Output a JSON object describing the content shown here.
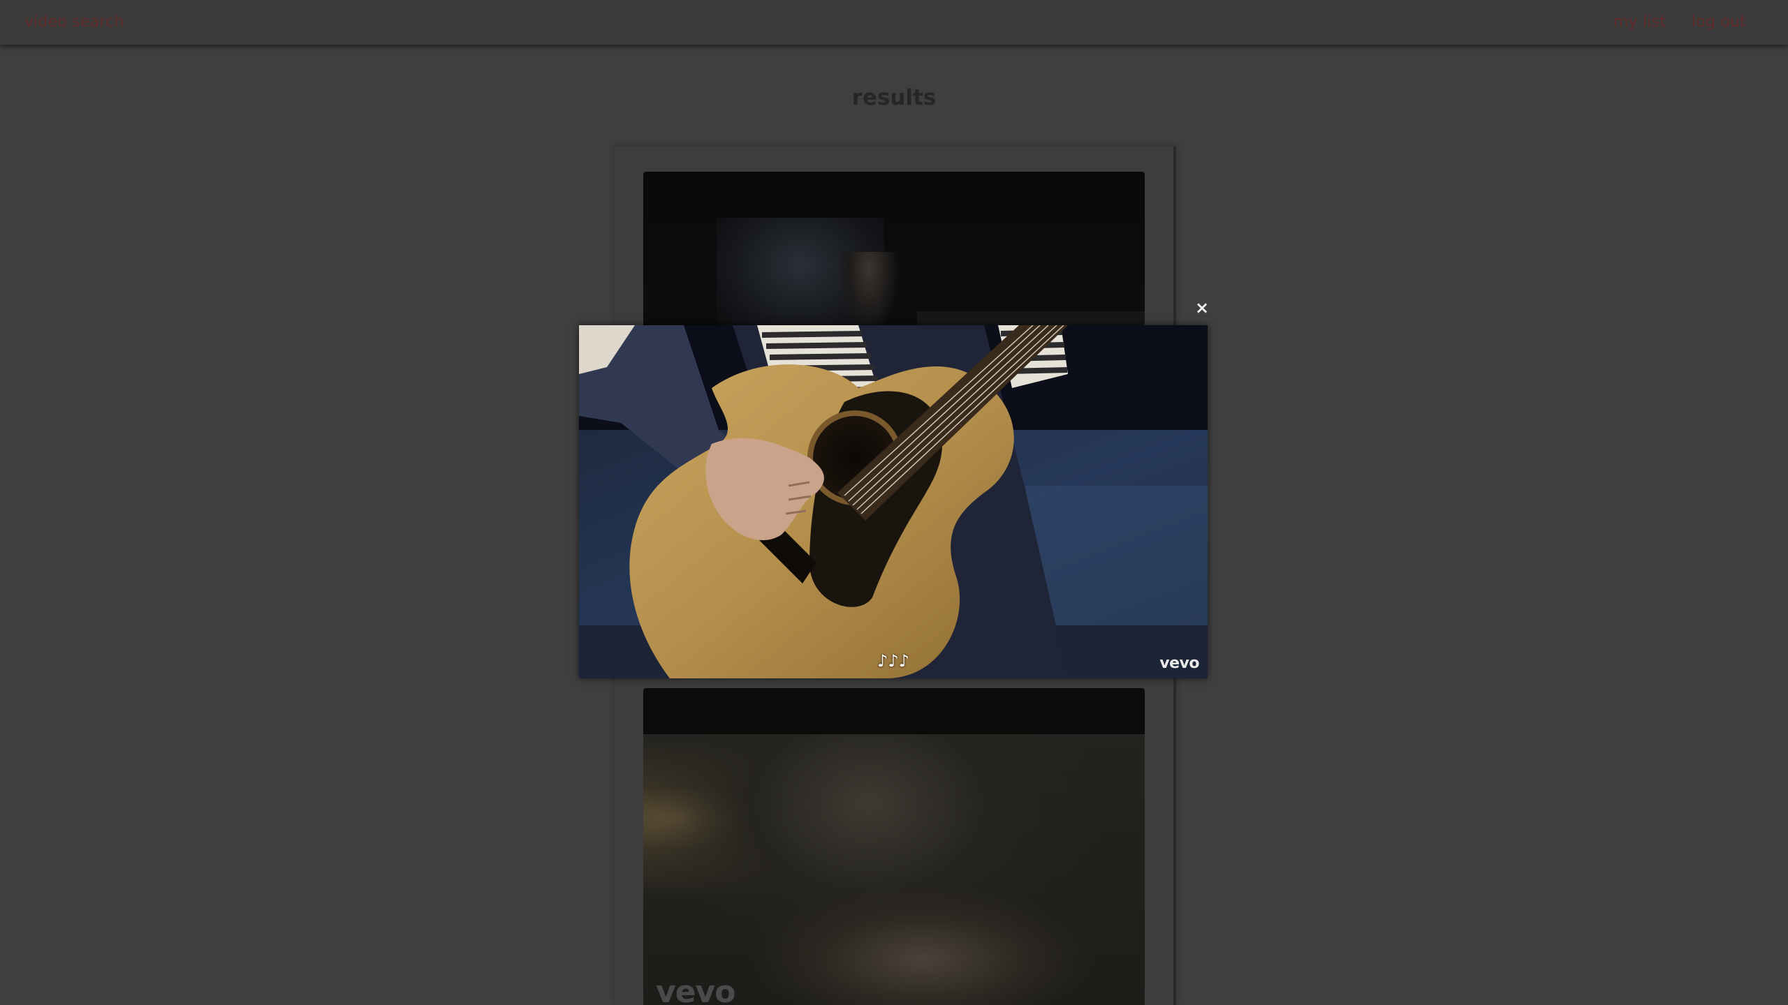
{
  "nav": {
    "brand": "video search",
    "links": [
      {
        "label": "my list"
      },
      {
        "label": "log out"
      }
    ]
  },
  "main": {
    "title": "results"
  },
  "results": [
    {
      "type": "video-thumbnail"
    },
    {
      "type": "video-thumbnail",
      "watermark": "vevo"
    }
  ],
  "player": {
    "close_label": "×",
    "captions": "♪♪♪",
    "watermark": "vevo"
  },
  "colors": {
    "background": "#3f3f3f",
    "nav_link": "#5e2a28",
    "title": "#262626"
  }
}
